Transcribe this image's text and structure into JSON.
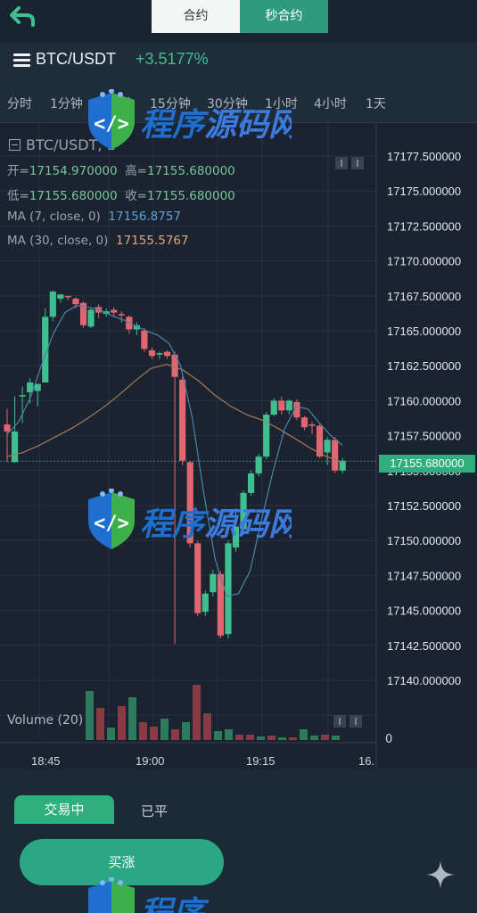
{
  "header": {
    "back_icon": "back-arrow-icon",
    "tabs": [
      {
        "label": "合约",
        "active": false
      },
      {
        "label": "秒合约",
        "active": true
      }
    ]
  },
  "pair": {
    "menu_icon": "hamburger-menu-icon",
    "name": "BTC/USDT",
    "change": "+3.5177%",
    "change_color": "#3fbf8f"
  },
  "intervals": [
    "分时",
    "1分钟",
    "5分钟",
    "15分钟",
    "30分钟",
    "1小时",
    "4小时",
    "1天"
  ],
  "chart": {
    "title": "BTC/USDT, 1",
    "open_label": "开=",
    "open_value": "17154.970000",
    "high_label": "高=",
    "high_value": "17155.680000",
    "low_label": "低=",
    "low_value": "17155.680000",
    "close_label": "收=",
    "close_value": "17155.680000",
    "ma7_label": "MA (7, close, 0)",
    "ma7_value": "17156.8757",
    "ma30_label": "MA (30, close, 0)",
    "ma30_value": "17155.5767",
    "current_price": "17155.680000",
    "volume_label": "Volume (20)",
    "volume_zero": "0",
    "time_labels": [
      "18:45",
      "19:00",
      "19:15",
      "16."
    ]
  },
  "chart_data": {
    "type": "candlestick",
    "y_ticks": [
      "17177.500000",
      "17175.000000",
      "17172.500000",
      "17170.000000",
      "17167.500000",
      "17165.000000",
      "17162.500000",
      "17160.000000",
      "17157.500000",
      "17155.000000",
      "17152.500000",
      "17150.000000",
      "17147.500000",
      "17145.000000",
      "17142.500000",
      "17140.000000"
    ],
    "ylim": [
      17138,
      17179
    ],
    "up_color": "#3fbf8f",
    "down_color": "#e0676f",
    "candles": [
      [
        17158.3,
        17157.8,
        17155.6,
        17159.4
      ],
      [
        17155.6,
        17157.8,
        17155.6,
        17160.3
      ],
      [
        17160.3,
        17160.4,
        17158.4,
        17161.0
      ],
      [
        17160.6,
        17161.3,
        17159.8,
        17161.6
      ],
      [
        17160.7,
        17161.2,
        17159.6,
        17161.1
      ],
      [
        17161.3,
        17166.0,
        17161.3,
        17166.6
      ],
      [
        17166.0,
        17167.8,
        17165.7,
        17167.9
      ],
      [
        17167.3,
        17167.6,
        17167.0,
        17167.6
      ],
      [
        17167.5,
        17167.4,
        17167.2,
        17167.5
      ],
      [
        17167.3,
        17166.9,
        17166.6,
        17167.4
      ],
      [
        17167.0,
        17165.4,
        17165.2,
        17167.1
      ],
      [
        17165.3,
        17166.5,
        17165.2,
        17166.6
      ],
      [
        17166.7,
        17166.3,
        17165.9,
        17166.9
      ],
      [
        17166.2,
        17166.4,
        17166.0,
        17166.6
      ],
      [
        17166.5,
        17166.3,
        17166.0,
        17166.7
      ],
      [
        17166.2,
        17166.1,
        17165.6,
        17166.4
      ],
      [
        17166.0,
        17165.1,
        17164.8,
        17166.1
      ],
      [
        17165.1,
        17165.4,
        17164.7,
        17165.6
      ],
      [
        17165.0,
        17163.7,
        17163.5,
        17165.2
      ],
      [
        17163.6,
        17163.2,
        17163.0,
        17163.8
      ],
      [
        17163.3,
        17163.4,
        17163.0,
        17163.5
      ],
      [
        17163.5,
        17163.2,
        17163.0,
        17163.6
      ],
      [
        17163.3,
        17161.7,
        17142.6,
        17163.5
      ],
      [
        17161.5,
        17155.7,
        17155.4,
        17161.7
      ],
      [
        17155.6,
        17149.8,
        17149.5,
        17155.7
      ],
      [
        17149.8,
        17144.8,
        17144.6,
        17150.0
      ],
      [
        17144.9,
        17146.2,
        17144.6,
        17146.4
      ],
      [
        17146.3,
        17147.6,
        17146.0,
        17147.9
      ],
      [
        17147.6,
        17143.2,
        17143.0,
        17147.8
      ],
      [
        17143.3,
        17149.8,
        17143.0,
        17150.0
      ],
      [
        17149.5,
        17151.0,
        17149.2,
        17152.3
      ],
      [
        17150.8,
        17153.4,
        17150.4,
        17153.6
      ],
      [
        17153.4,
        17154.8,
        17153.2,
        17155.0
      ],
      [
        17154.8,
        17156.0,
        17154.6,
        17156.2
      ],
      [
        17156.0,
        17159.0,
        17155.8,
        17159.2
      ],
      [
        17159.0,
        17160.0,
        17158.9,
        17160.2
      ],
      [
        17160.0,
        17159.3,
        17159.0,
        17160.3
      ],
      [
        17159.3,
        17160.0,
        17159.0,
        17160.1
      ],
      [
        17159.9,
        17158.8,
        17158.6,
        17160.1
      ],
      [
        17158.8,
        17158.1,
        17157.9,
        17158.9
      ],
      [
        17158.3,
        17158.2,
        17157.6,
        17158.5
      ],
      [
        17158.2,
        17156.0,
        17155.9,
        17158.3
      ],
      [
        17156.3,
        17157.2,
        17155.4,
        17157.4
      ],
      [
        17157.2,
        17155.0,
        17154.8,
        17157.4
      ],
      [
        17155.0,
        17155.7,
        17154.8,
        17155.9
      ]
    ],
    "volumes": [
      0,
      0,
      0,
      0,
      0,
      0,
      0,
      0,
      0,
      0,
      0,
      0,
      0,
      0,
      0,
      0,
      0,
      0,
      0,
      0,
      0,
      0,
      0,
      0,
      0,
      0,
      0,
      0,
      0,
      0,
      0,
      0,
      0,
      0,
      0,
      0,
      0,
      0,
      0,
      0,
      0,
      0,
      0,
      0,
      0
    ],
    "volume_bars": [
      {
        "v": 55,
        "c": "up"
      },
      {
        "v": 36,
        "c": "down"
      },
      {
        "v": 14,
        "c": "up"
      },
      {
        "v": 38,
        "c": "down"
      },
      {
        "v": 48,
        "c": "up"
      },
      {
        "v": 20,
        "c": "down"
      },
      {
        "v": 15,
        "c": "down"
      },
      {
        "v": 24,
        "c": "up"
      },
      {
        "v": 12,
        "c": "down"
      },
      {
        "v": 20,
        "c": "up"
      },
      {
        "v": 62,
        "c": "down"
      },
      {
        "v": 30,
        "c": "down"
      },
      {
        "v": 10,
        "c": "up"
      },
      {
        "v": 12,
        "c": "up"
      },
      {
        "v": 6,
        "c": "down"
      },
      {
        "v": 6,
        "c": "down"
      },
      {
        "v": 4,
        "c": "up"
      },
      {
        "v": 5,
        "c": "down"
      },
      {
        "v": 3,
        "c": "up"
      },
      {
        "v": 3,
        "c": "down"
      },
      {
        "v": 12,
        "c": "up"
      },
      {
        "v": 5,
        "c": "up"
      },
      {
        "v": 6,
        "c": "down"
      },
      {
        "v": 5,
        "c": "up"
      }
    ],
    "ma7": [
      17157.6,
      17158.5,
      17160.2,
      17162.6,
      17164.8,
      17166.3,
      17166.8,
      17166.7,
      17166.5,
      17166.1,
      17165.8,
      17165.4,
      17165.0,
      17164.7,
      17164.1,
      17162.5,
      17158.8,
      17153.4,
      17148.6,
      17146.0,
      17146.2,
      17147.8,
      17151.5,
      17155.0,
      17158.0,
      17159.6,
      17159.4,
      17158.4,
      17157.5,
      17156.8
    ],
    "ma30": [
      17156.0,
      17156.3,
      17156.8,
      17157.4,
      17158.0,
      17158.7,
      17159.5,
      17160.4,
      17161.4,
      17162.3,
      17162.6,
      17162.2,
      17161.4,
      17160.4,
      17159.6,
      17159.0,
      17158.6,
      17158.0,
      17157.3,
      17156.6,
      17156.0,
      17155.6
    ]
  },
  "bottom": {
    "tab_active": "交易中",
    "tab_inactive": "已平",
    "buy_label": "买涨",
    "sparkle_icon": "sparkle-icon"
  },
  "watermark": {
    "text": "程序源码网",
    "logo": "code-shield-logo"
  }
}
